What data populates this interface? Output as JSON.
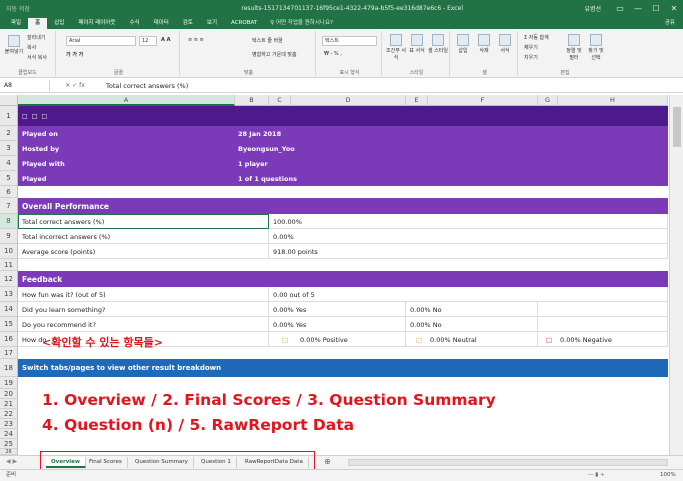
{
  "window": {
    "qat": "자동 저장",
    "title": "results-1517134701137-16f95ce1-4322-479a-b5f5-ee316d87e6c6  -  Excel",
    "user": "유병선",
    "controls": [
      "▭",
      "—",
      "☐",
      "✕"
    ]
  },
  "ribbon_tabs": [
    "파일",
    "홈",
    "삽입",
    "페이지 레이아웃",
    "수식",
    "데이터",
    "검토",
    "보기",
    "ACROBAT"
  ],
  "tell_me": "♀ 어떤 작업을 원하시나요?",
  "share": "공유",
  "ribbon": {
    "paste": "붙여넣기",
    "cut": "잘라내기",
    "copy": "복사",
    "format_painter": "서식 복사",
    "font_name": "Arial",
    "font_size": "12",
    "wrap_text": "텍스트 줄 바꿈",
    "merge_center": "병합하고 가운데 맞춤",
    "number_format": "텍스트",
    "cond_format": "조건부 서식",
    "format_table": "표 서식",
    "cell_styles": "셀 스타일",
    "insert": "삽입",
    "delete": "삭제",
    "format": "서식",
    "autosum": "Σ 자동 합계",
    "fill": "채우기",
    "clear": "지우기",
    "sort_filter": "정렬 및 필터",
    "find_select": "찾기 및 선택",
    "groups": [
      "클립보드",
      "글꼴",
      "맞춤",
      "표시 형식",
      "스타일",
      "셀",
      "편집"
    ]
  },
  "formula_bar": {
    "name_box": "A8",
    "fx": "✕ ✓ fx",
    "value": "Total correct answers (%)"
  },
  "columns": [
    "A",
    "B",
    "C",
    "D",
    "E",
    "F",
    "G",
    "H"
  ],
  "rows": [
    "1",
    "2",
    "3",
    "4",
    "5",
    "6",
    "7",
    "8",
    "9",
    "10",
    "11",
    "12",
    "13",
    "14",
    "15",
    "16",
    "17",
    "18",
    "19",
    "20",
    "21",
    "22",
    "23",
    "24",
    "25",
    "26"
  ],
  "sheet": {
    "r1_a": "□ □ □",
    "played_on_label": "Played on",
    "played_on_value": "28 Jan 2018",
    "hosted_by_label": "Hosted by",
    "hosted_by_value": "Byeongsun_Yoo",
    "played_with_label": "Played with",
    "played_with_value": "1 player",
    "played_label": "Played",
    "played_value": "1 of 1 questions",
    "overall_title": "Overall Performance",
    "total_correct_label": "Total correct answers (%)",
    "total_correct_value": "100.00%",
    "total_incorrect_label": "Total incorrect answers (%)",
    "total_incorrect_value": "0.00%",
    "avg_score_label": "Average score (points)",
    "avg_score_value": "918.00 points",
    "feedback_title": "Feedback",
    "fun_label": "How fun was it? (out of 5)",
    "fun_value": "0.00 out of 5",
    "learn_label": "Did you learn something?",
    "learn_yes": "0.00% Yes",
    "learn_no": "0.00% No",
    "recommend_label": "Do you recommend it?",
    "recommend_yes": "0.00% Yes",
    "recommend_no": "0.00% No",
    "feel_label": "How do",
    "feel_positive": "0.00% Positive",
    "feel_neutral": "0.00% Neutral",
    "feel_negative": "0.00% Negative",
    "feel_icon": "□",
    "switch_text": "Switch tabs/pages to view other result breakdown"
  },
  "annotation": {
    "heading": "<확인할 수 있는 항목들>",
    "line1": "1. Overview / 2. Final Scores / 3. Question Summary",
    "line2": "4. Question (n) / 5. RawReport Data"
  },
  "sheet_tabs": [
    "Overview",
    "Final Scores",
    "Question Summary",
    "Question 1",
    "RawReportData Data"
  ],
  "status": {
    "ready": "준비",
    "zoom": "100%"
  },
  "colors": {
    "excel_green": "#217346",
    "purple_dark": "#4e1a8b",
    "purple": "#7b3bb8",
    "blue": "#1e6ab8",
    "annotation_red": "#e2141d"
  }
}
